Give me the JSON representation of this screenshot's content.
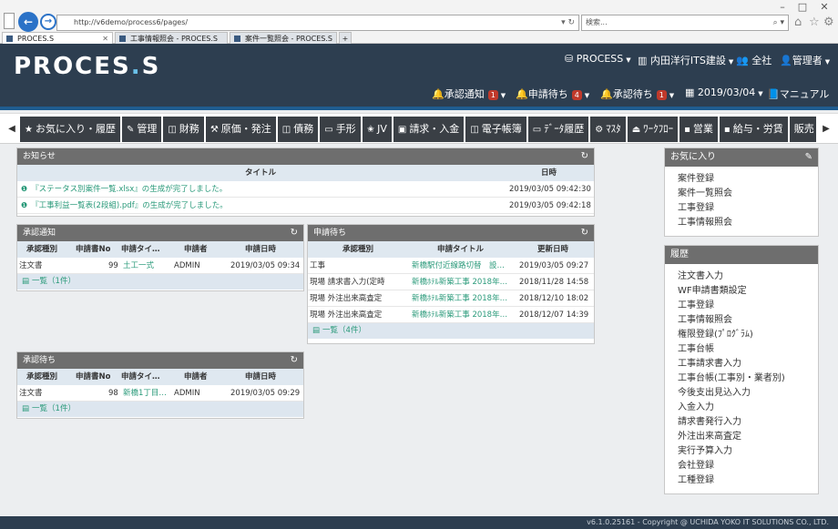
{
  "browser": {
    "address": "http://v6demo/process6/pages/",
    "search_placeholder": "検索...",
    "tabs": [
      {
        "label": "PROCES.S"
      },
      {
        "label": "工事情報照会 - PROCES.S"
      },
      {
        "label": "案件一覧照会 - PROCES.S"
      }
    ]
  },
  "header": {
    "logo": {
      "part1": "PROCES",
      "dot": ".",
      "part2": "S"
    },
    "top_nav": [
      {
        "label": "PROCESS",
        "icon": "database-icon"
      },
      {
        "label": "内田洋行ITS建設",
        "icon": "building-icon"
      },
      {
        "label": "全社",
        "icon": "group-icon"
      },
      {
        "label": "管理者",
        "icon": "user-icon"
      }
    ],
    "notif_nav": [
      {
        "label": "承認通知",
        "badge": "1",
        "icon": "bell-icon"
      },
      {
        "label": "申請待ち",
        "badge": "4",
        "icon": "bell-outline-icon"
      },
      {
        "label": "承認待ち",
        "badge": "1",
        "icon": "bell-outline-icon"
      },
      {
        "label": "2019/03/04",
        "icon": "calendar-icon"
      },
      {
        "label": "マニュアル",
        "icon": "book-icon"
      }
    ]
  },
  "menu": [
    {
      "label": "お気に入り・履歴",
      "icon": "star-icon"
    },
    {
      "label": "管理",
      "icon": "wrench-icon"
    },
    {
      "label": "財務",
      "icon": "ledger-icon"
    },
    {
      "label": "原価・発注",
      "icon": "hammer-icon"
    },
    {
      "label": "債務",
      "icon": "ledger-icon"
    },
    {
      "label": "手形",
      "icon": "card-icon"
    },
    {
      "label": "JV",
      "icon": "star-half-icon"
    },
    {
      "label": "請求・入金",
      "icon": "money-icon"
    },
    {
      "label": "電子帳簿",
      "icon": "ledger-icon"
    },
    {
      "label": "ﾃﾞｰﾀ履歴",
      "icon": "monitor-icon"
    },
    {
      "label": "ﾏｽﾀ",
      "icon": "gear-icon"
    },
    {
      "label": "ﾜｰｸﾌﾛｰ",
      "icon": "inbox-icon"
    },
    {
      "label": "営業",
      "icon": "briefcase-icon"
    },
    {
      "label": "給与・労賃",
      "icon": "wallet-icon"
    },
    {
      "label": "販売",
      "icon": ""
    },
    {
      "label": "¥",
      "icon": ""
    }
  ],
  "notices": {
    "title": "お知らせ",
    "col_title": "タイトル",
    "col_date": "日時",
    "rows": [
      {
        "text": "『ステータス別案件一覧.xlsx』の生成が完了しました。",
        "date": "2019/03/05 09:42:30"
      },
      {
        "text": "『工事利益一覧表(2段組).pdf』の生成が完了しました。",
        "date": "2019/03/05 09:42:18"
      }
    ]
  },
  "approval_notice": {
    "title": "承認通知",
    "headers": [
      "承認種別",
      "申請書No",
      "申請タイ…",
      "申請者",
      "申請日時"
    ],
    "rows": [
      {
        "type": "注文書",
        "no": "99",
        "title": "土工一式",
        "applicant": "ADMIN",
        "date": "2019/03/05 09:34"
      }
    ],
    "footer": "一覧（1件）"
  },
  "pending_apply": {
    "title": "申請待ち",
    "headers": [
      "承認種別",
      "申請タイトル",
      "更新日時"
    ],
    "rows": [
      {
        "type": "工事",
        "title": "新橋駅付近線路切替　設…",
        "date": "2019/03/05 09:27"
      },
      {
        "type": "現場 請求書入力(定時",
        "title": "新橋ﾎﾃﾙ新築工事 2018年…",
        "date": "2018/11/28 14:58"
      },
      {
        "type": "現場 外注出来高査定",
        "title": "新橋ﾎﾃﾙ新築工事 2018年…",
        "date": "2018/12/10 18:02"
      },
      {
        "type": "現場 外注出来高査定",
        "title": "新橋ﾎﾃﾙ新築工事 2018年…",
        "date": "2018/12/07 14:39"
      }
    ],
    "footer": "一覧（4件）"
  },
  "pending_approval": {
    "title": "承認待ち",
    "headers": [
      "承認種別",
      "申請書No",
      "申請タイ…",
      "申請者",
      "申請日時"
    ],
    "rows": [
      {
        "type": "注文書",
        "no": "98",
        "title": "新橋1丁目…",
        "applicant": "ADMIN",
        "date": "2019/03/05 09:29"
      }
    ],
    "footer": "一覧（1件）"
  },
  "favorites": {
    "title": "お気に入り",
    "items": [
      "案件登録",
      "案件一覧照会",
      "工事登録",
      "工事情報照会"
    ]
  },
  "history": {
    "title": "履歴",
    "items": [
      "注文書入力",
      "WF申請書類設定",
      "工事登録",
      "工事情報照会",
      "権限登録(ﾌﾟﾛｸﾞﾗﾑ)",
      "工事台帳",
      "工事請求書入力",
      "工事台帳(工事別・業者別)",
      "今後支出見込入力",
      "入金入力",
      "請求書発行入力",
      "外注出来高査定",
      "実行予算入力",
      "会社登録",
      "工種登録"
    ]
  },
  "footer": {
    "text": "v6.1.0.25161 - Copyright @ UCHIDA YOKO IT SOLUTIONS CO., LTD."
  },
  "colors": {
    "header_bg": "#2d3e50",
    "menu_bg": "#3a3f45",
    "link": "#2a9a7a",
    "badge": "#c0392b",
    "accent": "#1f5c8f"
  }
}
